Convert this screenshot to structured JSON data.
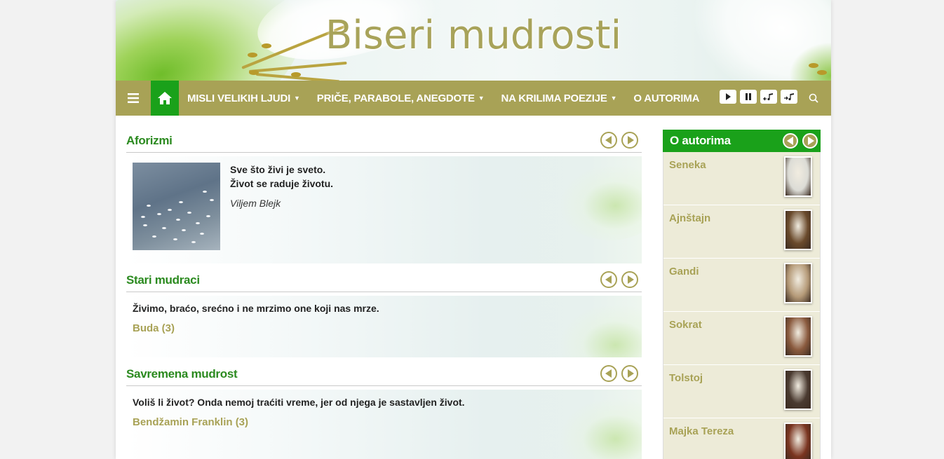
{
  "site": {
    "title": "Biseri mudrosti"
  },
  "nav": {
    "menu_icon": "hamburger-icon",
    "home_icon": "home-icon",
    "items": [
      {
        "label": "MISLI VELIKIH LJUDI",
        "has_dropdown": true
      },
      {
        "label": "PRIČE, PARABOLE, ANEGDOTE",
        "has_dropdown": true
      },
      {
        "label": "NA KRILIMA POEZIJE",
        "has_dropdown": true
      },
      {
        "label": "O AUTORIMA",
        "has_dropdown": false
      }
    ],
    "controls": [
      "play-icon",
      "pause-icon",
      "music-prev-icon",
      "music-next-icon"
    ],
    "search_icon": "search-icon"
  },
  "sections": {
    "aforizmi": {
      "title": "Aforizmi",
      "lines": [
        "Sve što živi je sveto.",
        "Život se raduje životu."
      ],
      "author": "Viljem Blejk"
    },
    "stari_mudraci": {
      "title": "Stari mudraci",
      "quote": "Živimo, braćo, srećno i ne mrzimo one koji nas mrze.",
      "author": "Buda (3)"
    },
    "savremena": {
      "title": "Savremena mudrost",
      "quote": "Voliš li život? Onda nemoj traćiti vreme, jer od njega je sastavljen život.",
      "author": "Bendžamin Franklin (3)"
    }
  },
  "sidebar": {
    "title": "O autorima",
    "authors": [
      {
        "name": "Seneka",
        "tone": "#dcdcd6"
      },
      {
        "name": "Ajnštajn",
        "tone": "#6a4a2c"
      },
      {
        "name": "Gandi",
        "tone": "#b59a78"
      },
      {
        "name": "Sokrat",
        "tone": "#8a5a3e"
      },
      {
        "name": "Tolstoj",
        "tone": "#4a3a30"
      },
      {
        "name": "Majka Tereza",
        "tone": "#7a3420"
      }
    ]
  },
  "colors": {
    "accent": "#a8a256",
    "green": "#1aa11a",
    "heading": "#2b8a1f"
  }
}
